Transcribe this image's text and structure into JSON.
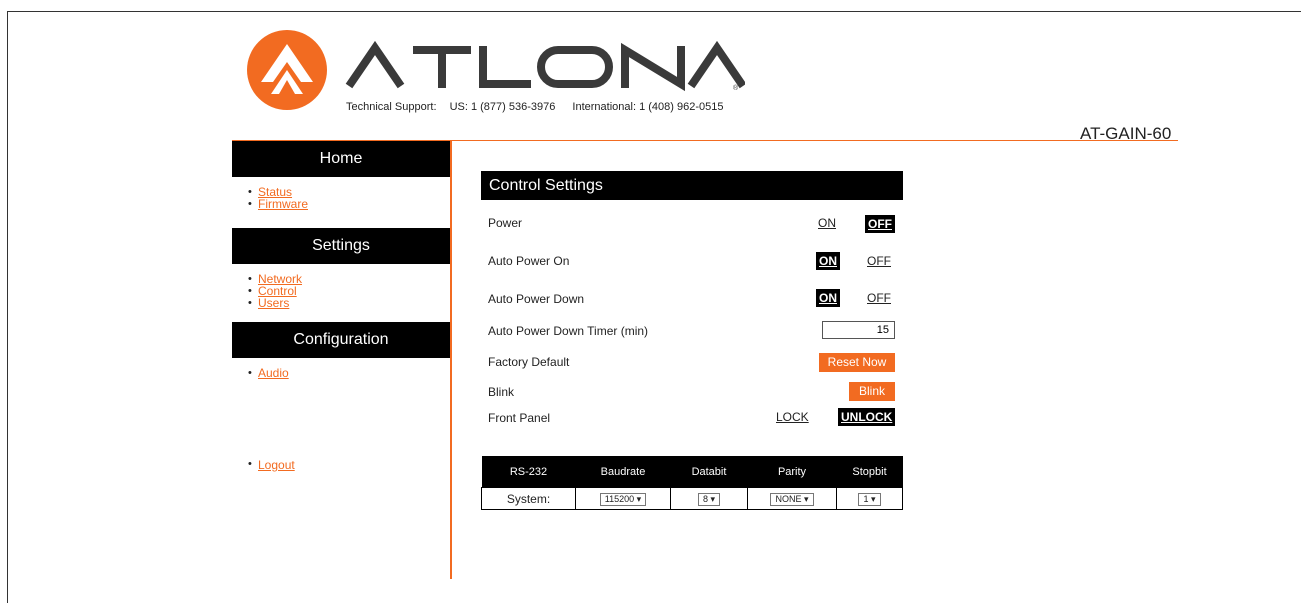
{
  "brand": {
    "name": "ATLONA",
    "orange": "#f26b21",
    "black": "#000000"
  },
  "support": {
    "label": "Technical Support:",
    "us": "US: 1 (877) 536-3976",
    "intl": "International: 1 (408) 962-0515"
  },
  "device_name": "AT-GAIN-60",
  "sidebar": {
    "home": {
      "title": "Home",
      "items": [
        "Status",
        "Firmware"
      ]
    },
    "settings": {
      "title": "Settings",
      "items": [
        "Network",
        "Control",
        "Users"
      ]
    },
    "configuration": {
      "title": "Configuration",
      "items": [
        "Audio"
      ]
    },
    "logout": "Logout"
  },
  "control": {
    "title": "Control Settings",
    "power": {
      "label": "Power",
      "on": "ON",
      "off": "OFF",
      "state": "OFF"
    },
    "auto_power_on": {
      "label": "Auto Power On",
      "on": "ON",
      "off": "OFF",
      "state": "ON"
    },
    "auto_power_down": {
      "label": "Auto Power Down",
      "on": "ON",
      "off": "OFF",
      "state": "ON"
    },
    "timer": {
      "label": "Auto Power Down Timer (min)",
      "value": "15"
    },
    "factory_default": {
      "label": "Factory Default",
      "button": "Reset Now"
    },
    "blink": {
      "label": "Blink",
      "button": "Blink"
    },
    "front_panel": {
      "label": "Front Panel",
      "lock": "LOCK",
      "unlock": "UNLOCK",
      "state": "UNLOCK"
    }
  },
  "rs232": {
    "headers": [
      "RS-232",
      "Baudrate",
      "Databit",
      "Parity",
      "Stopbit"
    ],
    "row": {
      "name": "System:",
      "baudrate": "115200",
      "databit": "8",
      "parity": "NONE",
      "stopbit": "1"
    }
  }
}
